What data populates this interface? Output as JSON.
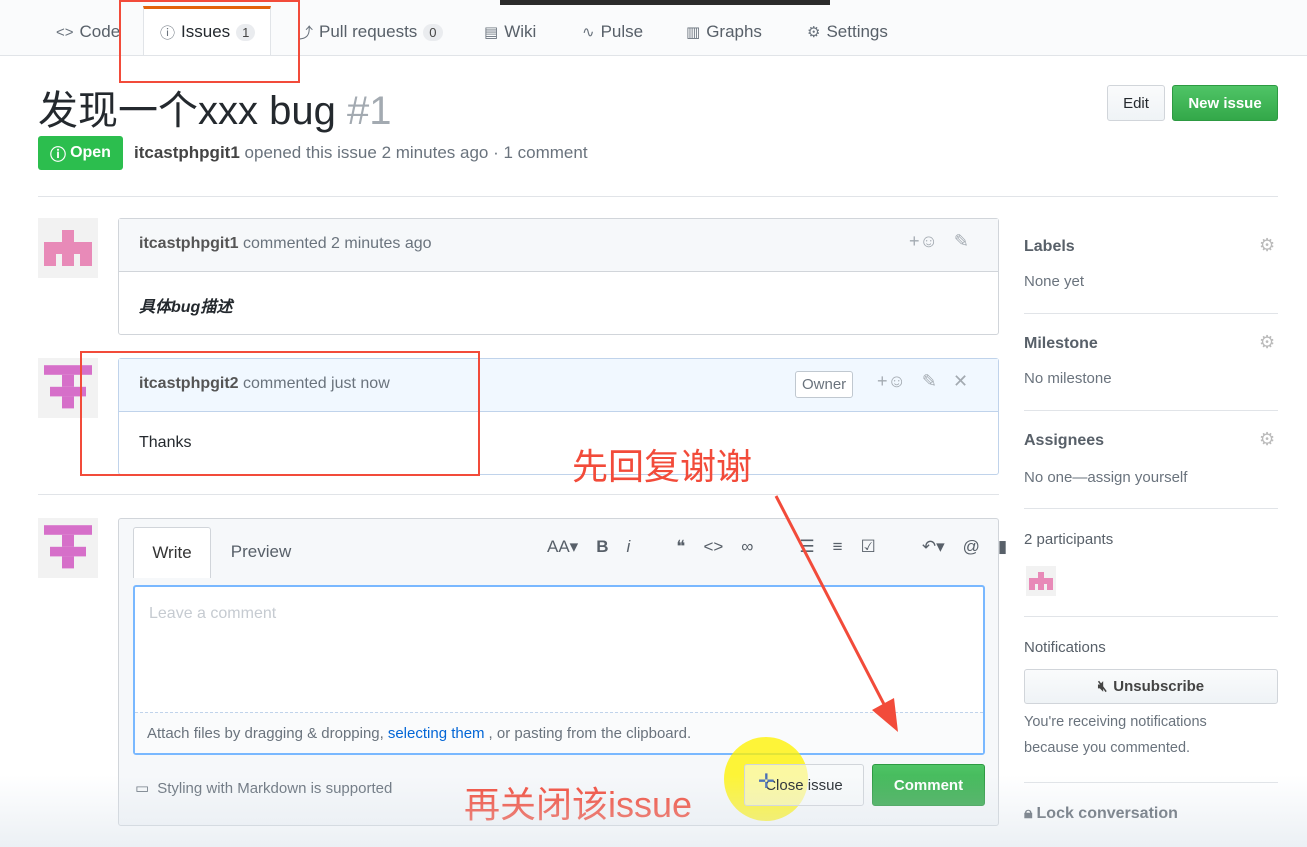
{
  "nav": {
    "tabs": [
      {
        "icon": "code-icon",
        "label": "Code"
      },
      {
        "icon": "issue-opened-icon",
        "label": "Issues",
        "count": "1"
      },
      {
        "icon": "git-pull-request-icon",
        "label": "Pull requests",
        "count": "0"
      },
      {
        "icon": "book-icon",
        "label": "Wiki"
      },
      {
        "icon": "pulse-icon",
        "label": "Pulse"
      },
      {
        "icon": "graph-icon",
        "label": "Graphs"
      },
      {
        "icon": "gear-icon",
        "label": "Settings"
      }
    ]
  },
  "issue": {
    "title": "发现一个xxx bug",
    "number": "#1",
    "state": "Open",
    "author": "itcastphpgit1",
    "opened_text": "opened this issue 2 minutes ago · 1 comment",
    "edit_label": "Edit",
    "new_issue_label": "New issue"
  },
  "comments": [
    {
      "author": "itcastphpgit1",
      "time": "commented 2 minutes ago",
      "body": "具体bug描述"
    },
    {
      "author": "itcastphpgit2",
      "time": "commented just now",
      "badge": "Owner",
      "body": "Thanks"
    }
  ],
  "composer": {
    "write_tab": "Write",
    "preview_tab": "Preview",
    "placeholder": "Leave a comment",
    "attach_prefix": "Attach files by dragging & dropping,",
    "attach_link": "selecting them",
    "attach_suffix": ", or pasting from the clipboard.",
    "markdown_note": "Styling with Markdown is supported",
    "close_issue_label": "Close issue",
    "comment_label": "Comment"
  },
  "sidebar": {
    "labels": {
      "title": "Labels",
      "value": "None yet"
    },
    "milestone": {
      "title": "Milestone",
      "value": "No milestone"
    },
    "assignees": {
      "title": "Assignees",
      "value": "No one—assign yourself"
    },
    "participants": {
      "title": "2 participants"
    },
    "notifications": {
      "title": "Notifications",
      "unsubscribe_label": "Unsubscribe",
      "reason_line1": "You're receiving notifications",
      "reason_line2": "because you commented."
    },
    "lock_label": "Lock conversation"
  },
  "annotations": {
    "reply_thanks": "先回复谢谢",
    "close_issue_note": "再关闭该issue",
    "color": "#f24b3a"
  },
  "colors": {
    "open_green": "#2cbe4e",
    "highlight_yellow": "#fff200",
    "tab_accent": "#e36209"
  }
}
